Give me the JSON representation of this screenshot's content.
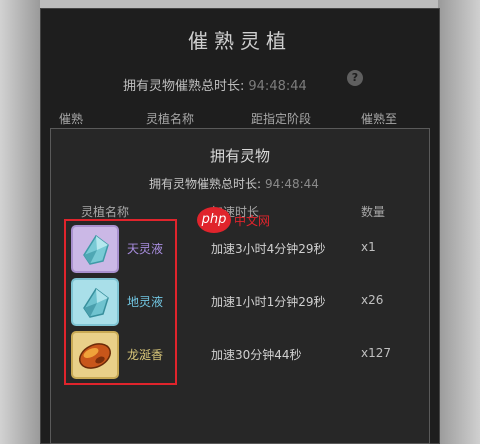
{
  "window": {
    "title": "催熟灵植",
    "total_label": "拥有灵物催熟总时长:",
    "total_value": "94:48:44",
    "help": "?",
    "columns": [
      "催熟",
      "灵植名称",
      "距指定阶段",
      "催熟至"
    ]
  },
  "dialog": {
    "title": "拥有灵物",
    "total_label": "拥有灵物催熟总时长:",
    "total_value": "94:48:44",
    "columns": [
      "灵植名称",
      "加速时长",
      "数量"
    ],
    "items": [
      {
        "name": "天灵液",
        "speed": "加速3小时4分钟29秒",
        "qty": "x1",
        "rarity_color": "#a98ee0",
        "icon": "crystal-drop-icon"
      },
      {
        "name": "地灵液",
        "speed": "加速1小时1分钟29秒",
        "qty": "x26",
        "rarity_color": "#72c7e3",
        "icon": "crystal-drop-icon"
      },
      {
        "name": "龙涎香",
        "speed": "加速30分钟44秒",
        "qty": "x127",
        "rarity_color": "#d9c77a",
        "icon": "amber-stone-icon"
      }
    ]
  },
  "watermark": {
    "logo": "php",
    "text": "中文网"
  },
  "colors": {
    "highlight": "#e0242c",
    "panel": "#1e1e1e",
    "dialog": "#272727"
  }
}
